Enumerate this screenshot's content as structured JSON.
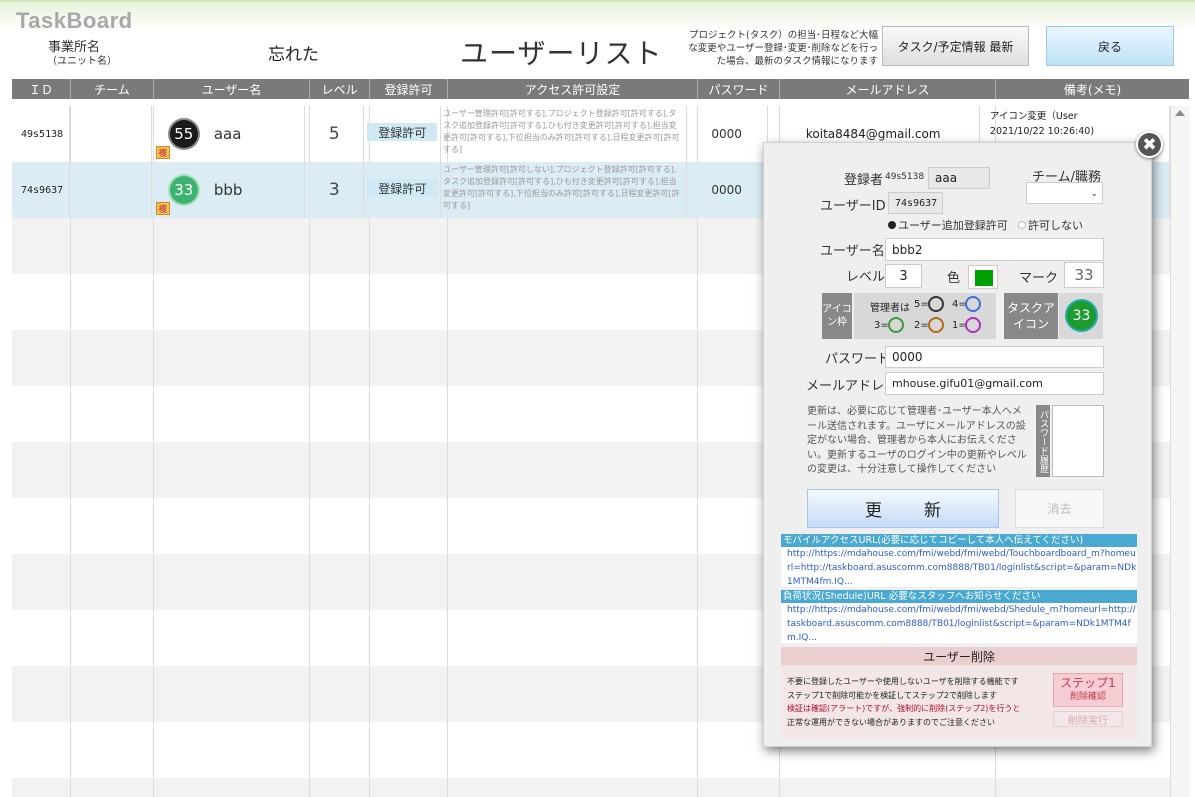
{
  "header": {
    "logo": "TaskBoard",
    "office_name": "事業所名",
    "unit_name": "（ユニット名）",
    "forgot": "忘れた",
    "title": "ユーザーリスト",
    "hint": "プロジェクト(タスク）の担当･日程など大幅な変更やユーザー登録･変更･削除などを行った場合、最新のタスク情報になります",
    "latest_button": "タスク/予定情報  最新",
    "back_button": "戻る"
  },
  "table": {
    "columns": [
      "ＩＤ",
      "チーム",
      "ユーザー名",
      "レベル",
      "登録許可",
      "アクセス許可設定",
      "パスワード",
      "メールアドレス",
      "備考(メモ)"
    ],
    "rows": [
      {
        "id": "49s5138",
        "team": "",
        "icon_number": "55",
        "icon_color": "#1a1a1a",
        "icon_ring": "#888888",
        "username": "aaa",
        "dup_mark": "複",
        "level": "5",
        "permission": "登録許可",
        "access": "ユーザー管理許可[許可する],プロジェクト登録許可[許可する],タスク追加登録許可[許可する],ひも付き変更許可[許可する],担当変更許可[許可する],下位担当のみ許可[許可する],日程変更許可[許可する]",
        "password": "0000",
        "email": "koita8484@gmail.com",
        "memo": [
          "アイコン変更（User",
          "2021/10/22 10:26:40)"
        ]
      },
      {
        "id": "74s9637",
        "team": "",
        "icon_number": "33",
        "icon_color": "#3cb371",
        "icon_ring": "#a8e0b8",
        "username": "bbb",
        "dup_mark": "複",
        "level": "3",
        "permission": "登録許可",
        "access": "ユーザー管理許可[許可しない],プロジェクト登録許可[許可する],タスク追加登録許可[許可する],ひも付き変更許可[許可する],担当変更許可[許可する],下位担当のみ許可[許可する],日程変更許可[許可する]",
        "password": "0000",
        "email": "",
        "memo": [
          "",
          ""
        ]
      }
    ]
  },
  "dialog": {
    "close": "✖",
    "registrant_label": "登録者",
    "registrant_id": "49s5138",
    "registrant_name": "aaa",
    "team_label": "チーム/職務",
    "userid_label": "ユーザーID",
    "userid": "74s9637",
    "radio_allow": "ユーザー追加登録許可",
    "radio_deny": "許可しない",
    "username_label": "ユーザー名",
    "username": "bbb2",
    "level_label": "レベル",
    "level": "3",
    "color_label": "色",
    "color_value": "#00a000",
    "mark_label": "マーク",
    "mark": "33",
    "frame_label": "アイコン枠",
    "admin_label": "管理者は",
    "ring_labels": [
      "5=",
      "4=",
      "3=",
      "2=",
      "1="
    ],
    "ring_colors": [
      "#333333",
      "#3b6fe0",
      "#3c9a3c",
      "#b06a20",
      "#b030c0"
    ],
    "task_icon_label": "タスクアイコン",
    "task_icon": "33",
    "password_label": "パスワード",
    "password": "0000",
    "email_label": "メールアドレス",
    "email": "mhouse.gifu01@gmail.com",
    "note": "更新は、必要に応じて管理者･ユーザー本人へメール送信されます。ユーザにメールアドレスの設定がない場合、管理者から本人にお伝えください。更新するユーザのログイン中の更新やレベルの変更は、十分注意して操作してください",
    "history_label": "パスワード履歴",
    "update_button": "更新",
    "clear_button": "消去",
    "mobile_url_head": "モバイルアクセスURL(必要に応じてコピーして本人へ伝えてください)",
    "mobile_url": "http://https://mdahouse.com/fmi/webd/fmi/webd/Touchboardboard_m?homeurl=http://taskboard.asuscomm.com8888/TB01/loginlist&script=&param=NDk1MTM4fm.IQ...",
    "shedule_url_head": "負荷状況(Shedule)URL 必要なスタッフへお知らせください",
    "shedule_url": "http://https://mdahouse.com/fmi/webd/fmi/webd/Shedule_m?homeurl=http://taskboard.asuscomm.com8888/TB01/loginlist&script=&param=NDk1MTM4fm.IQ...",
    "delete_head": "ユーザー削除",
    "delete_text1": "不要に登録したユーザーや使用しないユーザを削除する機能です",
    "delete_text2": "ステップ1で削除可能かを検証してステップ2で削除します",
    "delete_warn1": "検証は確認(アラート)ですが、強制的に削除(ステップ2)を行うと",
    "delete_warn2": "正常な運用ができない場合がありますのでご注意ください",
    "step1_label": "ステップ1",
    "step1_sub": "削除確認",
    "step2_label": "削除実行"
  }
}
